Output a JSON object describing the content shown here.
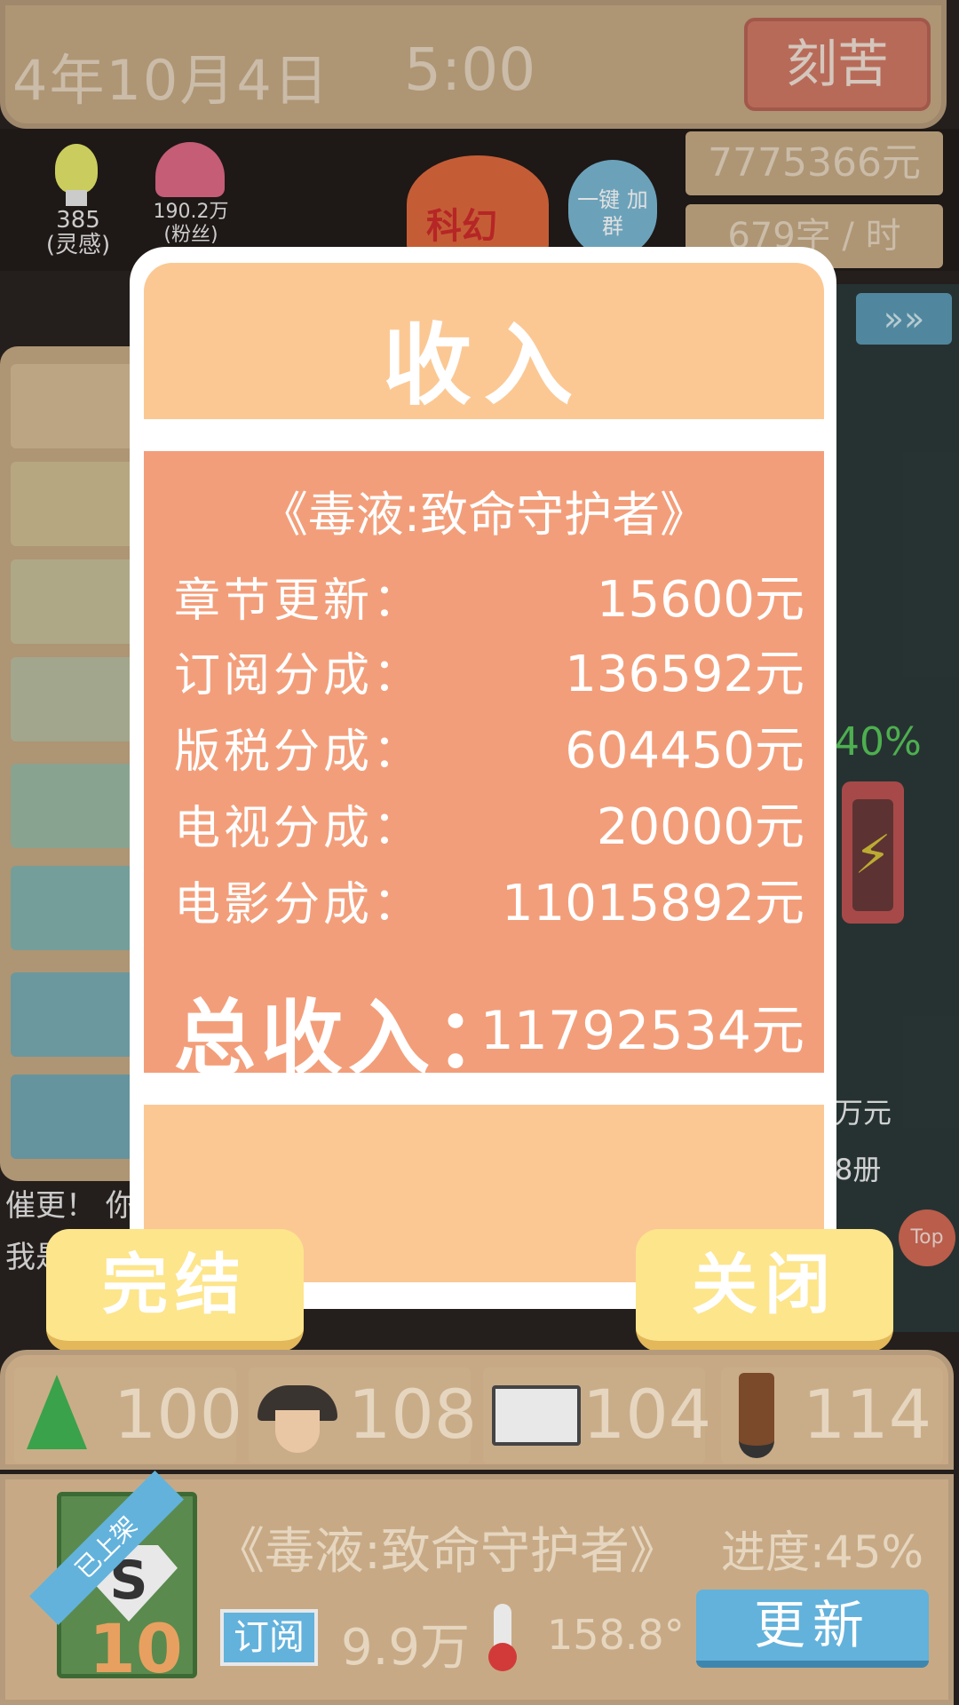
{
  "header": {
    "date": "4年10月4日",
    "time": "5:00",
    "diligent_button": "刻苦"
  },
  "stats_top": {
    "money": "7775366元",
    "speed": "679字 / 时"
  },
  "indicators": {
    "inspiration_value": "385",
    "inspiration_label": "(灵感)",
    "fans_value": "190.2万",
    "fans_label": "(粉丝)",
    "genre": "科幻",
    "qq_group": "一键 加群"
  },
  "side": {
    "arrows": "»»",
    "percent": "40%",
    "money_suffix": "万元",
    "books_suffix": "8册",
    "top_button": "Top"
  },
  "chat": {
    "line1": "催更！ 你",
    "line2": "我是"
  },
  "dialog": {
    "title": "收入",
    "book_title": "《毒液:致命守护者》",
    "rows": [
      {
        "label": "章节更新：",
        "value": "15600元"
      },
      {
        "label": "订阅分成：",
        "value": "136592元"
      },
      {
        "label": "版税分成：",
        "value": "604450元"
      },
      {
        "label": "电视分成：",
        "value": "20000元"
      },
      {
        "label": "电影分成：",
        "value": "11015892元"
      }
    ],
    "total_label": "总收入：",
    "total_value": "11792534元",
    "finish_button": "完结",
    "close_button": "关闭"
  },
  "attributes": [
    {
      "icon": "tree-icon",
      "value": "100"
    },
    {
      "icon": "detective-icon",
      "value": "108"
    },
    {
      "icon": "open-book-icon",
      "value": "104"
    },
    {
      "icon": "pencil-icon",
      "value": "114"
    }
  ],
  "book": {
    "ribbon": "已上架",
    "cover_number": "10",
    "title": "《毒液:致命守护者》",
    "progress": "进度:45%",
    "subscribe_label": "订阅",
    "subscribers": "9.9万",
    "heat": "158.8°",
    "update_button": "更新"
  },
  "colors": {
    "panel": "#c7aa85",
    "dialog_header": "#fbc894",
    "dialog_body": "#f39e7a",
    "button_yellow": "#fde58c",
    "button_red": "#d27965",
    "button_blue": "#62b2dc"
  }
}
